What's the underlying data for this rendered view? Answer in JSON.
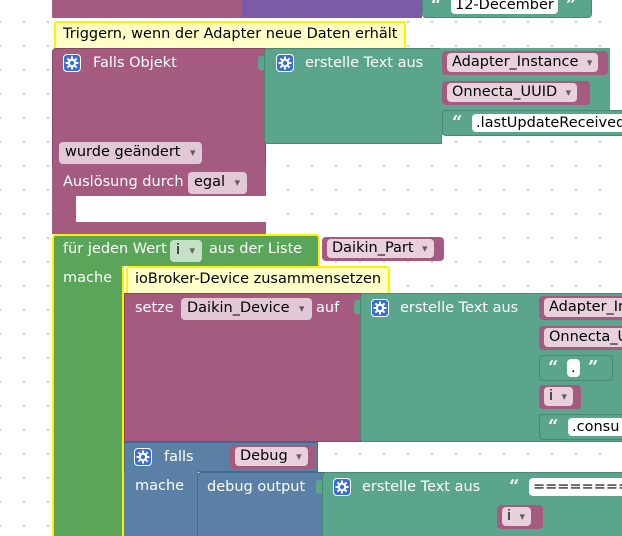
{
  "top": {
    "date_value": "12-December"
  },
  "trigger_comment": "Triggern, wenn der Adapter neue Daten erhält",
  "trigger_block": {
    "label": "Falls Objekt",
    "create_text_label": "erstelle Text aus",
    "items": [
      "Adapter_Instance",
      "Onnecta_UUID",
      ".lastUpdateReceived"
    ],
    "condition_value": "wurde geändert",
    "trigger_by_label": "Auslösung durch",
    "trigger_by_value": "egal"
  },
  "loop": {
    "prefix": "für jeden Wert",
    "var": "i",
    "middle": "aus der Liste",
    "list": "Daikin_Part",
    "do_label": "mache"
  },
  "device_comment": "ioBroker-Device zusammensetzen",
  "set_block": {
    "label": "setze",
    "var": "Daikin_Device",
    "to_label": "auf",
    "create_text_label": "erstelle Text aus",
    "items": [
      "Adapter_In",
      "Onnecta_U",
      ".",
      "i",
      ".consu"
    ]
  },
  "if_block": {
    "label": "falls",
    "condition": "Debug",
    "do_label": "mache",
    "debug_label": "debug output",
    "create_text_label": "erstelle Text aus",
    "string_value": "=========",
    "var": "i"
  },
  "colors": {
    "event": "#a55b80",
    "text": "#5ba58c",
    "loop": "#5ba55b",
    "logic": "#5b80a5",
    "time": "#7b5ba5",
    "comment_border": "#fff200",
    "comment_bg": "#ffffc7"
  },
  "icons": [
    "gear-icon"
  ]
}
